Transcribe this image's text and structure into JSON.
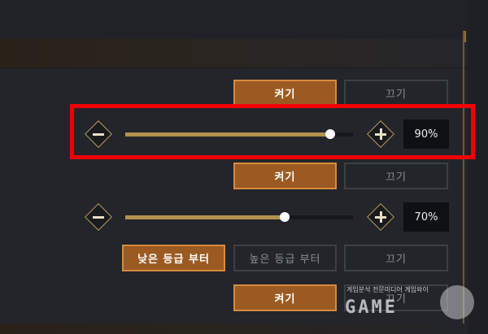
{
  "row1": {
    "on_label": "켜기",
    "off_label": "끄기"
  },
  "slider1": {
    "value": 90,
    "display": "90%"
  },
  "row3": {
    "on_label": "켜기",
    "off_label": "끄기"
  },
  "slider2": {
    "value": 70,
    "display": "70%"
  },
  "row5": {
    "low_label": "낮은 등급 부터",
    "high_label": "높은 등급 부터",
    "off_label": "끄기"
  },
  "row6": {
    "on_label": "켜기",
    "off_label": "끄기"
  },
  "watermark": {
    "caption": "게임분석 전문미디어 게임와이",
    "logo": "GAME"
  },
  "colors": {
    "accent": "#d88b3e",
    "button_on": "#9b5a22",
    "slider_fill": "#b3924f",
    "highlight": "#f20000"
  },
  "icons": {
    "minus": "minus-icon",
    "plus": "plus-icon"
  }
}
